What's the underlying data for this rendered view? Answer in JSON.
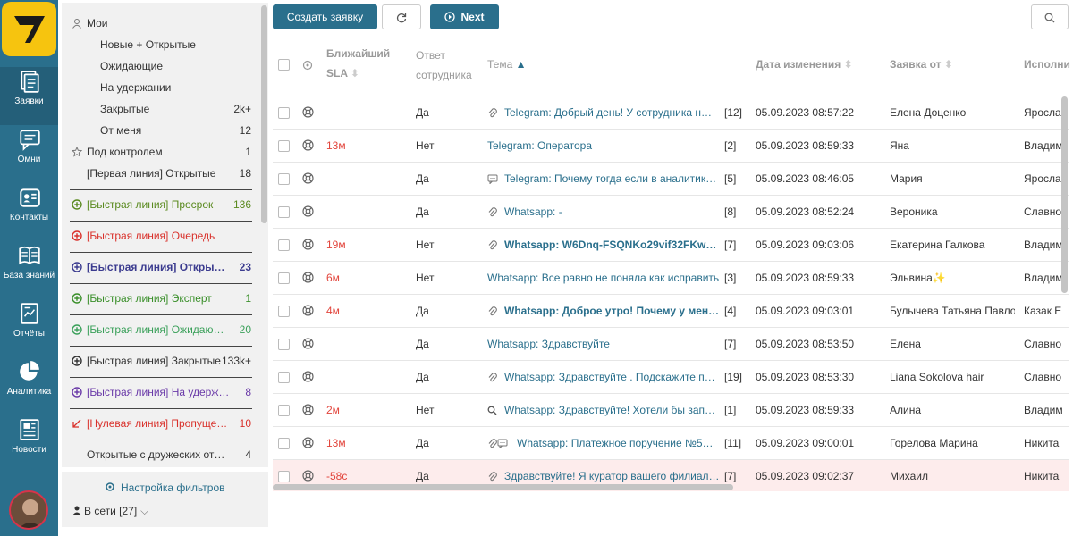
{
  "nav": {
    "items": [
      {
        "label": "Заявки",
        "icon": "tickets-icon"
      },
      {
        "label": "Омни",
        "icon": "chat-icon"
      },
      {
        "label": "Контакты",
        "icon": "contacts-icon"
      },
      {
        "label": "База знаний",
        "icon": "book-icon"
      },
      {
        "label": "Отчёты",
        "icon": "report-icon"
      },
      {
        "label": "Аналитика",
        "icon": "pie-chart-icon"
      },
      {
        "label": "Новости",
        "icon": "news-icon"
      }
    ]
  },
  "filters": {
    "my_label": "Мои",
    "sub": [
      {
        "label": "Новые + Открытые",
        "count": ""
      },
      {
        "label": "Ожидающие",
        "count": ""
      },
      {
        "label": "На удержании",
        "count": ""
      },
      {
        "label": "Закрытые",
        "count": "2k+"
      },
      {
        "label": "От меня",
        "count": "12"
      }
    ],
    "control": {
      "label": "Под контролем",
      "count": "1"
    },
    "first_line": {
      "label": "[Первая линия] Открытые",
      "count": "18"
    },
    "groups": [
      {
        "label": "[Быстрая линия] Просрок",
        "count": "136",
        "color": "#5a8a1f",
        "bold": false,
        "icon": "plus-circle-icon"
      },
      {
        "label": "[Быстрая линия] Очередь",
        "count": "",
        "color": "#d9312b",
        "bold": false,
        "icon": "plus-circle-icon"
      },
      {
        "label": "[Быстрая линия] Открыт…",
        "count": "23",
        "color": "#3b3b8f",
        "bold": true,
        "icon": "plus-circle-icon"
      },
      {
        "label": "[Быстрая линия] Эксперт",
        "count": "1",
        "color": "#3a8f2a",
        "bold": false,
        "icon": "plus-circle-icon"
      },
      {
        "label": "[Быстрая линия] Ожидаю…",
        "count": "20",
        "color": "#3aa05a",
        "bold": false,
        "icon": "plus-circle-icon"
      },
      {
        "label": "[Быстрая линия] Закрытые",
        "count": "133k+",
        "color": "#333333",
        "bold": false,
        "icon": "plus-circle-icon"
      },
      {
        "label": "[Быстрая линия] На удерж…",
        "count": "8",
        "color": "#6a3aa8",
        "bold": false,
        "icon": "plus-circle-icon"
      },
      {
        "label": "[Нулевая линия] Пропуще…",
        "count": "10",
        "color": "#d9312b",
        "bold": false,
        "icon": "arrow-down-left-icon"
      },
      {
        "label": "Открытые с дружеских от…",
        "count": "4",
        "color": "#333333",
        "bold": false,
        "icon": ""
      }
    ],
    "setup_label": "Настройка фильтров",
    "online_label": "В сети [27]"
  },
  "toolbar": {
    "create_label": "Создать заявку",
    "next_label": "Next"
  },
  "table": {
    "headers": {
      "sla": "Ближайший SLA",
      "answer": "Ответ сотрудника",
      "subject": "Тема",
      "modified": "Дата изменения",
      "from": "Заявка от",
      "assignee": "Исполни"
    },
    "rows": [
      {
        "sla": "",
        "answer": "Да",
        "icons": "clip",
        "subject": "Telegram: Добрый день! У сотрудника н…",
        "bold": false,
        "count": "[12]",
        "date": "05.09.2023 08:57:22",
        "from": "Елена Доценко",
        "assignee": "Яросла",
        "highlight": false
      },
      {
        "sla": "13м",
        "answer": "Нет",
        "icons": "",
        "subject": "Telegram: Оператора",
        "bold": false,
        "count": "[2]",
        "date": "05.09.2023 08:59:33",
        "from": "Яна",
        "assignee": "Владим",
        "highlight": false
      },
      {
        "sla": "",
        "answer": "Да",
        "icons": "comment",
        "subject": "Telegram: Почему тогда если в аналитик…",
        "bold": false,
        "count": "[5]",
        "date": "05.09.2023 08:46:05",
        "from": "Мария",
        "assignee": "Яросла",
        "highlight": false
      },
      {
        "sla": "",
        "answer": "Да",
        "icons": "clip",
        "subject": "Whatsapp: -",
        "bold": false,
        "count": "[8]",
        "date": "05.09.2023 08:52:24",
        "from": "Вероника",
        "assignee": "Славно",
        "highlight": false
      },
      {
        "sla": "19м",
        "answer": "Нет",
        "icons": "clip",
        "subject": "Whatsapp: W6Dnq-FSQNKo29vif32FKw…",
        "bold": true,
        "count": "[7]",
        "date": "05.09.2023 09:03:06",
        "from": "Екатерина Галкова",
        "assignee": "Владим",
        "highlight": false
      },
      {
        "sla": "6м",
        "answer": "Нет",
        "icons": "",
        "subject": "Whatsapp: Все равно не поняла как исправить",
        "bold": false,
        "count": "[3]",
        "date": "05.09.2023 08:59:33",
        "from": "Эльвина✨",
        "assignee": "Владим",
        "highlight": false
      },
      {
        "sla": "4м",
        "answer": "Да",
        "icons": "clip",
        "subject": "Whatsapp: Доброе утро! Почему у мен…",
        "bold": true,
        "count": "[4]",
        "date": "05.09.2023 09:03:01",
        "from": "Булычева Татьяна Павло",
        "assignee": "Казак Е",
        "highlight": false
      },
      {
        "sla": "",
        "answer": "Да",
        "icons": "",
        "subject": "Whatsapp: Здравствуйте",
        "bold": false,
        "count": "[7]",
        "date": "05.09.2023 08:53:50",
        "from": "Елена",
        "assignee": "Славно",
        "highlight": false
      },
      {
        "sla": "",
        "answer": "Да",
        "icons": "clip",
        "subject": "Whatsapp: Здравствуйте . Подскажите п…",
        "bold": false,
        "count": "[19]",
        "date": "05.09.2023 08:53:30",
        "from": "Liana Sokolova hair",
        "assignee": "Славно",
        "highlight": false
      },
      {
        "sla": "2м",
        "answer": "Нет",
        "icons": "search",
        "subject": "Whatsapp: Здравствуйте! Хотели бы зап…",
        "bold": false,
        "count": "[1]",
        "date": "05.09.2023 08:59:33",
        "from": "Алина",
        "assignee": "Владим",
        "highlight": false
      },
      {
        "sla": "13м",
        "answer": "Да",
        "icons": "clip-comment",
        "subject": "Whatsapp: Платежное поручение №5…",
        "bold": false,
        "count": "[11]",
        "date": "05.09.2023 09:00:01",
        "from": "Горелова Марина",
        "assignee": "Никита",
        "highlight": false
      },
      {
        "sla": "-58с",
        "answer": "Да",
        "icons": "clip",
        "subject": "Здравствуйте! Я куратор вашего филиал…",
        "bold": false,
        "count": "[7]",
        "date": "05.09.2023 09:02:37",
        "from": "Михаил",
        "assignee": "Никита",
        "highlight": true
      }
    ]
  }
}
